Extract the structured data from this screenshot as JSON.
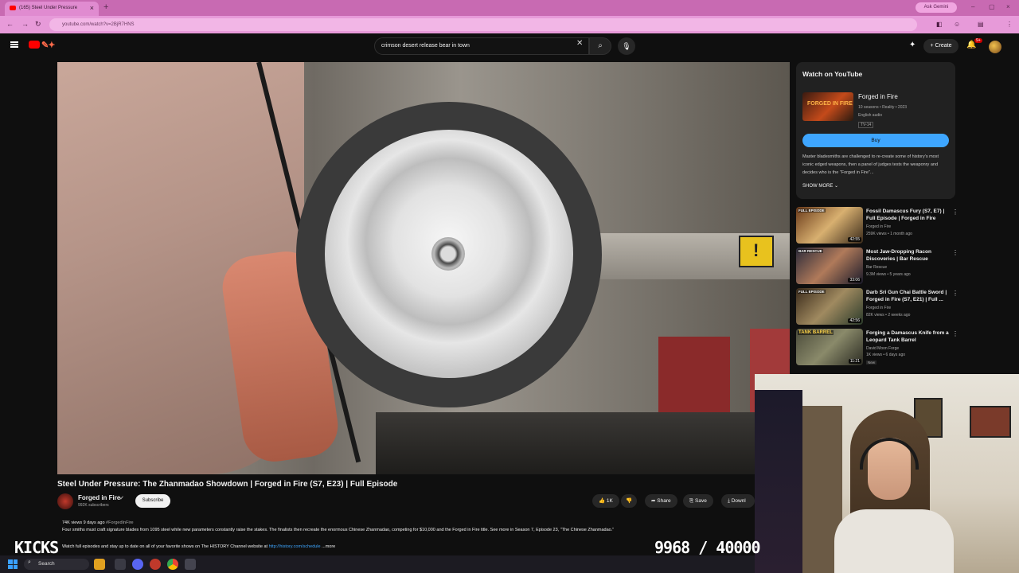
{
  "browser": {
    "tab_title": "(165) Steel Under Pressure",
    "url": "youtube.com/watch?v=2BjR7HNS",
    "ask_gemini": "Ask Gemini"
  },
  "youtube": {
    "search_query": "crimson desert release bear in town",
    "create_label": "Create",
    "notification_count": "9+"
  },
  "video": {
    "title": "Steel Under Pressure: The Zhanmadao Showdown | Forged in Fire (S7, E23) | Full Episode",
    "channel": "Forged in Fire",
    "subscribers": "992K subscribers",
    "subscribe_label": "Subscribe",
    "likes": "1K",
    "share_label": "Share",
    "save_label": "Save",
    "download_label": "Downl",
    "views_date": "74K views  9 days ago",
    "hashtag": "#ForgedInFire",
    "description_line1": "Four smiths must craft signature blades from 1095 steel while new parameters constantly raise the stakes. The finalists then recreate the enormous Chinese Zhanmadao, competing for $10,000 and the Forged in Fire title. See more in Season 7, Episode 23, \"The Chinese Zhanmadao.\"",
    "description_line2_prefix": "Watch full episodes and stay up to date on all of your favorite shows on The HISTORY Channel website at ",
    "description_link": "http://history.com/schedule",
    "description_more": "...more"
  },
  "watch_panel": {
    "heading": "Watch on YouTube",
    "show_title": "Forged in Fire",
    "show_meta": "10 seasons • Reality • 2023",
    "audio": "English audio",
    "rating": "TV-14",
    "buy_label": "Buy",
    "description": "Master bladesmiths are challenged to re-create some of history's most iconic edged weapons, then a panel of judges tests the weaponry and decides who is the \"Forged in Fire\"...",
    "show_more": "SHOW MORE",
    "thumb_text": "FORGED IN FIRE"
  },
  "recommendations": [
    {
      "title": "Fossil Damascus Fury (S7, E7) | Full Episode | Forged in Fire",
      "channel": "Forged in Fire",
      "views": "259K views • 1 month ago",
      "duration": "42:55",
      "badge": "FULL EPISODE",
      "is_new": false
    },
    {
      "title": "Most Jaw-Dropping Racon Discoveries | Bar Rescue",
      "channel": "Bar Rescue",
      "views": "9.3M views • 5 years ago",
      "duration": "33:06",
      "badge": "BAR RESCUE",
      "is_new": false
    },
    {
      "title": "Darb Sri Gun Chai Battle Sword | Forged in Fire (S7, E21) | Full ...",
      "channel": "Forged in Fire",
      "views": "82K views • 2 weeks ago",
      "duration": "42:56",
      "badge": "FULL EPISODE",
      "is_new": false
    },
    {
      "title": "Forging a Damascus Knife from a Leopard Tank Barrel",
      "channel": "David Moon Forge",
      "views": "1K views • 6 days ago",
      "duration": "11:21",
      "badge": "TANK BARREL",
      "is_new": true,
      "new_label": "New"
    }
  ],
  "overlay": {
    "kicks": "KICKS",
    "counter": "9968 / 40000"
  },
  "taskbar": {
    "search_label": "Search"
  },
  "colors": {
    "accent_blue": "#3ea6ff",
    "youtube_red": "#ff0000",
    "browser_pink": "#e79ad9"
  }
}
